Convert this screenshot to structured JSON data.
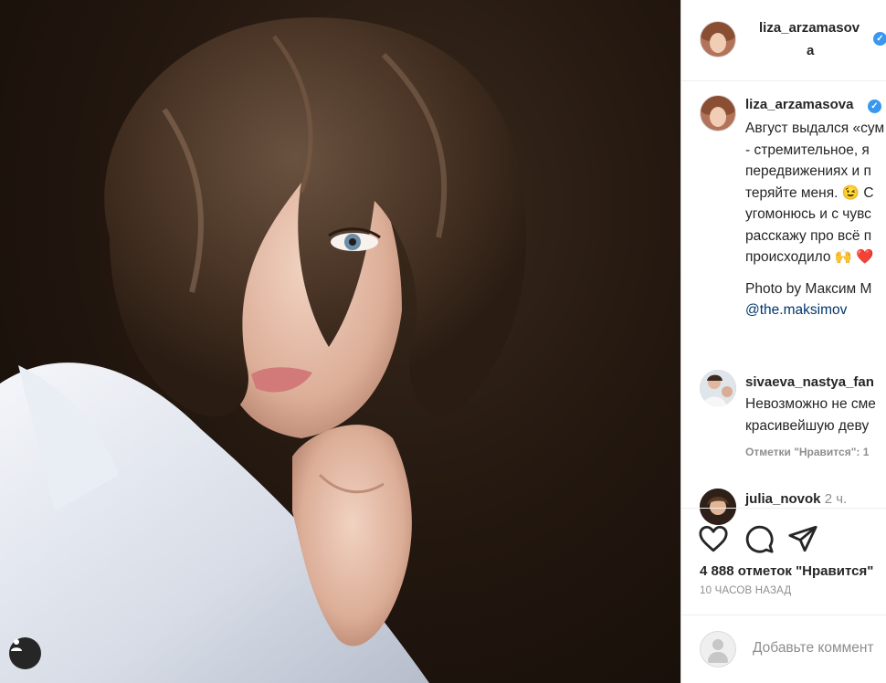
{
  "post": {
    "author": "liza_arzamasova",
    "header_username_line1": "liza_arzamasov",
    "header_username_line2": "a",
    "caption_lines": [
      "Август выдался «сум",
      "- стремительное, я",
      "передвижениях и п",
      "теряйте меня. 😉 С",
      "угомонюсь и с чувс",
      "расскажу про всё п",
      "происходило 🙌 ❤️"
    ],
    "credit": "Photo by Максим М",
    "mention": "@the.maksimov"
  },
  "comments": [
    {
      "user": "sivaeva_nastya_fan",
      "text_lines": [
        "Невозможно не сме",
        "красивейшую деву"
      ],
      "meta": "Отметки \"Нравится\": 1"
    },
    {
      "user": "julia_novok",
      "time": "2 ч."
    }
  ],
  "engagement": {
    "likes": "4 888 отметок \"Нравится\"",
    "time_ago": "10 ЧАСОВ НАЗАД"
  },
  "comment_input": {
    "placeholder": "Добавьте коммент"
  },
  "colors": {
    "verified": "#3897f0",
    "link": "#00376b",
    "muted": "#8e8e8e"
  },
  "icons": [
    "user-tag-icon",
    "heart-icon",
    "comment-icon",
    "share-icon",
    "verified-badge-icon"
  ]
}
